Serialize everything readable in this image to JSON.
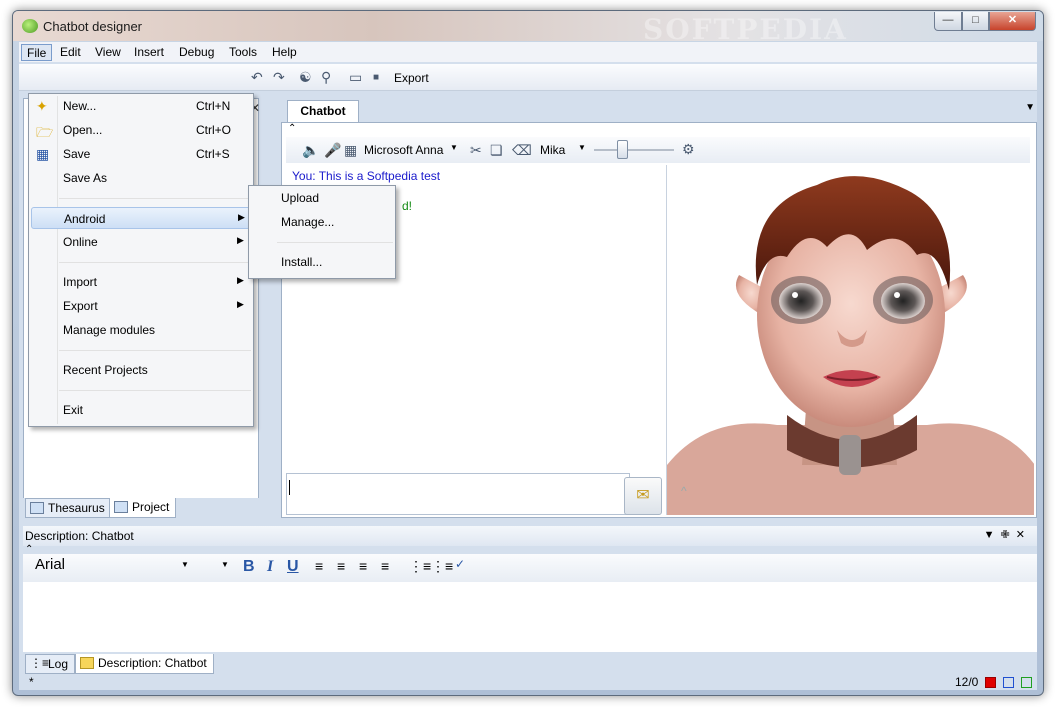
{
  "window": {
    "title": "Chatbot designer",
    "watermark": "SOFTPEDIA"
  },
  "menubar": [
    "File",
    "Edit",
    "View",
    "Insert",
    "Debug",
    "Tools",
    "Help"
  ],
  "toolbar": {
    "export_label": "Export"
  },
  "file_menu": {
    "new": "New...",
    "new_shortcut": "Ctrl+N",
    "open": "Open...",
    "open_shortcut": "Ctrl+O",
    "save": "Save",
    "save_shortcut": "Ctrl+S",
    "save_as": "Save As",
    "android": "Android",
    "online": "Online",
    "import": "Import",
    "export": "Export",
    "manage_modules": "Manage modules",
    "recent_projects": "Recent Projects",
    "exit": "Exit"
  },
  "android_submenu": {
    "upload": "Upload",
    "manage": "Manage...",
    "install": "Install..."
  },
  "left_tabs": {
    "thesaurus": "Thesaurus",
    "project": "Project"
  },
  "chat": {
    "tab": "Chatbot",
    "voice": "Microsoft Anna",
    "character": "Mika",
    "you_line": "You: This is a Softpedia test",
    "bot_line": "d!"
  },
  "description": {
    "title": "Description: Chatbot",
    "font": "Arial"
  },
  "bottom_tabs": {
    "log": "Log",
    "description": "Description: Chatbot"
  },
  "status": {
    "left": "*",
    "counter": "12/0",
    "colors": [
      "#e00000",
      "#2050d0",
      "#20a020"
    ]
  }
}
